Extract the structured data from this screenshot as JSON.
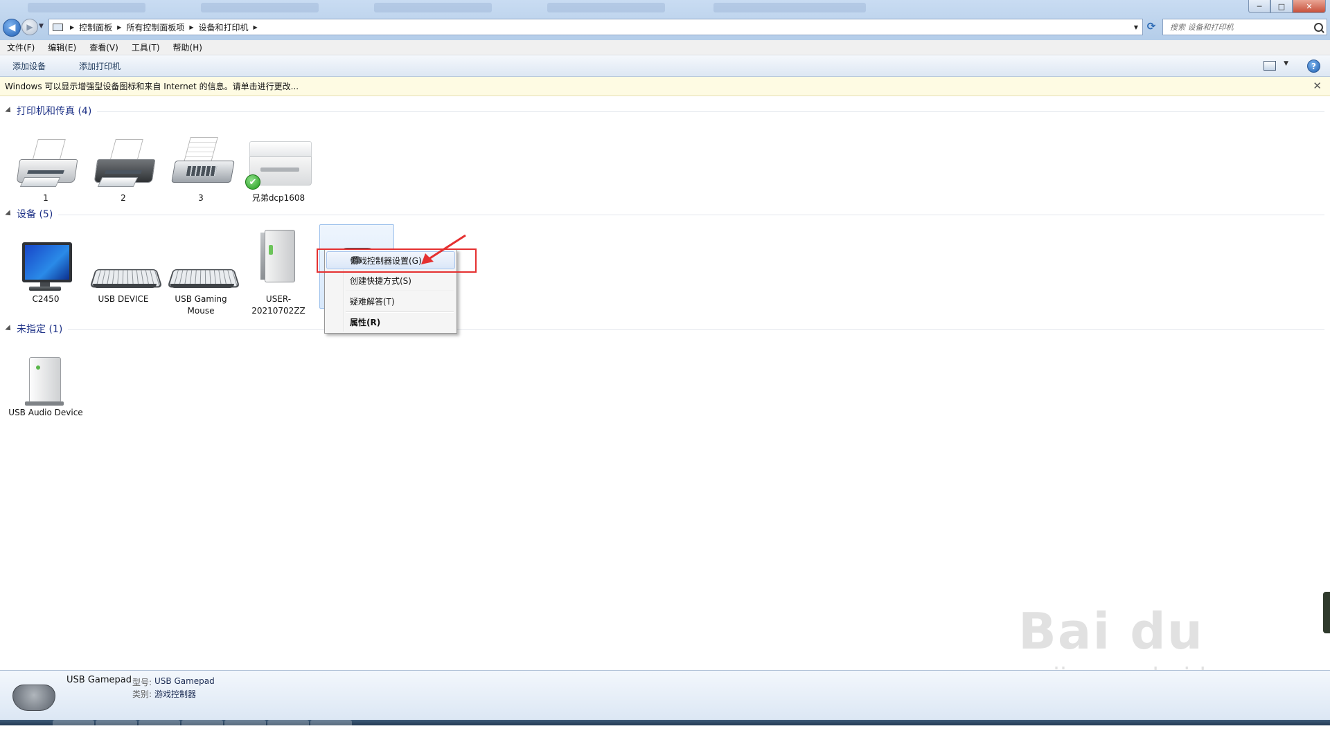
{
  "window": {
    "breadcrumb": [
      "控制面板",
      "所有控制面板项",
      "设备和打印机"
    ],
    "search_placeholder": "搜索 设备和打印机",
    "controls": {
      "minimize": "─",
      "maximize": "□",
      "close": "✕"
    }
  },
  "menubar": [
    "文件(F)",
    "编辑(E)",
    "查看(V)",
    "工具(T)",
    "帮助(H)"
  ],
  "toolbar": {
    "add_device": "添加设备",
    "add_printer": "添加打印机",
    "help": "?"
  },
  "infobar": {
    "text": "Windows 可以显示增强型设备图标和来自 Internet 的信息。请单击进行更改...",
    "close": "✕"
  },
  "groups": {
    "printers": {
      "title": "打印机和传真 (4)",
      "items": [
        {
          "label": "1",
          "icon": "printer-icon"
        },
        {
          "label": "2",
          "icon": "printer-icon"
        },
        {
          "label": "3",
          "icon": "fax-icon"
        },
        {
          "label": "兄弟dcp1608",
          "icon": "multifunction-printer-icon",
          "default": true
        }
      ]
    },
    "devices": {
      "title": "设备 (5)",
      "items": [
        {
          "label": "C2450",
          "icon": "monitor-icon"
        },
        {
          "label": "USB DEVICE",
          "icon": "keyboard-icon"
        },
        {
          "label": "USB Gaming Mouse",
          "icon": "keyboard-icon"
        },
        {
          "label": "USER-20210702ZZ",
          "icon": "computer-tower-icon"
        },
        {
          "label": "",
          "icon": "gamepad-icon",
          "selected": true
        }
      ]
    },
    "unspecified": {
      "title": "未指定 (1)",
      "items": [
        {
          "label": "USB Audio Device",
          "icon": "audio-device-icon"
        }
      ]
    }
  },
  "context_menu": {
    "items": [
      "游戏控制器设置(G)",
      "创建快捷方式(S)",
      "疑难解答(T)",
      "属性(R)"
    ]
  },
  "details": {
    "name": "USB Gamepad",
    "model_key": "型号:",
    "model_value": "USB Gamepad",
    "category_key": "类别:",
    "category_value": "游戏控制器"
  },
  "watermark": {
    "main": "Bai du 经验",
    "sub": "jingyan.baidu.com"
  },
  "colors": {
    "accent": "#1e3287",
    "highlight_border": "#e53030"
  }
}
